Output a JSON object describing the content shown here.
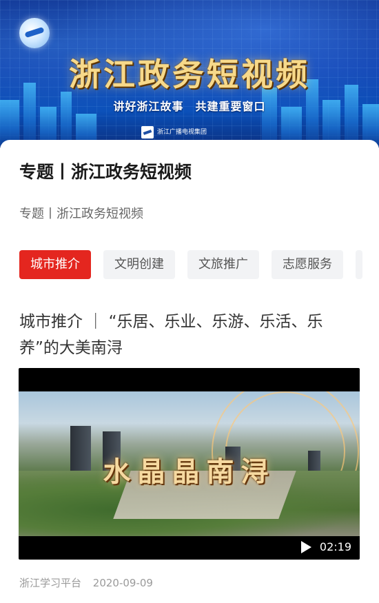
{
  "banner": {
    "title": "浙江政务短视频",
    "subtitle": "讲好浙江故事　共建重要窗口",
    "brand": "浙江广播电视集团"
  },
  "page": {
    "title": "专题丨浙江政务短视频",
    "breadcrumb": "专题丨浙江政务短视频"
  },
  "tabs": [
    {
      "label": "城市推介",
      "active": true
    },
    {
      "label": "文明创建",
      "active": false
    },
    {
      "label": "文旅推广",
      "active": false
    },
    {
      "label": "志愿服务",
      "active": false
    }
  ],
  "article": {
    "title": "城市推介 ｜ “乐居、乐业、乐游、乐活、乐养”的大美南浔",
    "video": {
      "overlay_title": "水晶晶南浔",
      "duration": "02:19"
    },
    "source": "浙江学习平台",
    "date": "2020-09-09"
  },
  "colors": {
    "accent": "#e4261f",
    "tab_bg": "#f2f3f5",
    "banner_blue": "#0b3aa8",
    "gold_text": "#f7d98a"
  },
  "icons": [
    "logo-mark-icon",
    "play-icon"
  ]
}
